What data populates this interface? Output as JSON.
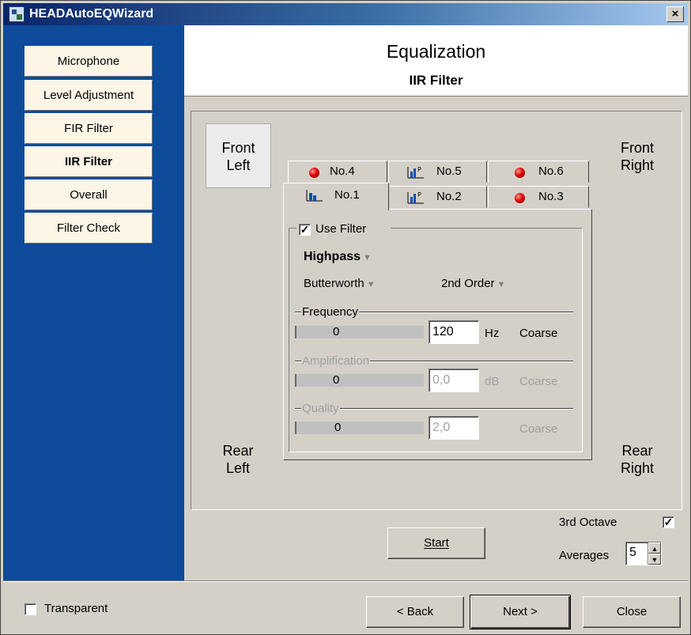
{
  "window": {
    "title": "HEADAutoEQWizard",
    "close_glyph": "×"
  },
  "sidebar": {
    "items": [
      {
        "label": "Microphone"
      },
      {
        "label": "Level Adjustment"
      },
      {
        "label": "FIR Filter"
      },
      {
        "label": "IIR Filter",
        "active": true
      },
      {
        "label": "Overall"
      },
      {
        "label": "Filter Check"
      }
    ]
  },
  "header": {
    "title": "Equalization",
    "subtitle": "IIR Filter"
  },
  "corners": {
    "front_left": "Front\nLeft",
    "front_right": "Front\nRight",
    "rear_left": "Rear\nLeft",
    "rear_right": "Rear\nRight"
  },
  "tabs": {
    "back_row": [
      {
        "label": "No.4",
        "icon": "red-led-icon"
      },
      {
        "label": "No.5",
        "icon": "filter-curve-icon"
      },
      {
        "label": "No.6",
        "icon": "red-led-icon"
      }
    ],
    "front_row": [
      {
        "label": "No.1",
        "icon": "filter-curve-icon",
        "active": true
      },
      {
        "label": "No.2",
        "icon": "filter-curve-icon"
      },
      {
        "label": "No.3",
        "icon": "red-led-icon"
      }
    ]
  },
  "filter": {
    "use_filter_label": "Use Filter",
    "use_filter_checked": true,
    "type": "Highpass",
    "characteristic": "Butterworth",
    "order": "2nd Order",
    "frequency": {
      "title": "Frequency",
      "slider_value": "0",
      "value": "120",
      "unit": "Hz",
      "mode": "Coarse"
    },
    "amplification": {
      "title": "Amplification",
      "slider_value": "0",
      "value": "0,0",
      "unit": "dB",
      "mode": "Coarse"
    },
    "quality": {
      "title": "Quality",
      "slider_value": "0",
      "value": "2,0",
      "mode": "Coarse"
    }
  },
  "controls": {
    "third_octave_label": "3rd Octave",
    "third_octave_checked": true,
    "start_label": "Start",
    "averages_label": "Averages",
    "averages_value": "5"
  },
  "footer": {
    "transparent_label": "Transparent",
    "transparent_checked": false,
    "back_label": "< Back",
    "next_label": "Next >",
    "close_label": "Close"
  }
}
